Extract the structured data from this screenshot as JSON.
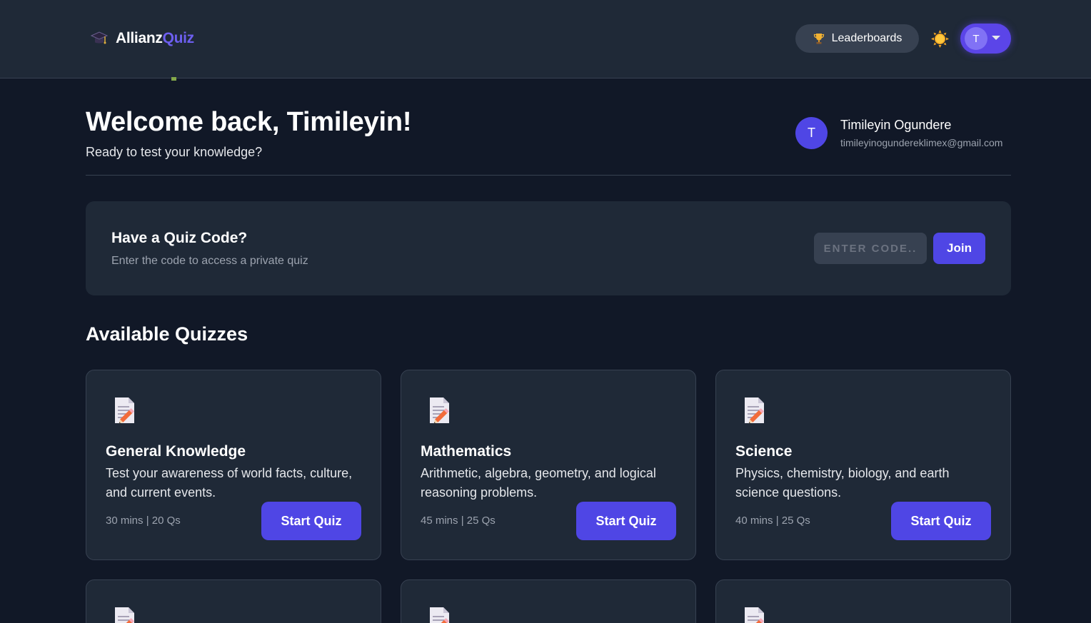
{
  "brand": {
    "name_part1": "Allianz",
    "name_part2": "Quiz",
    "icon": "graduation-cap-icon"
  },
  "nav": {
    "leaderboards_label": "Leaderboards",
    "leaderboards_icon": "trophy-icon",
    "theme_icon": "sun-icon",
    "user_initial": "T"
  },
  "welcome": {
    "title": "Welcome back, Timileyin!",
    "subtitle": "Ready to test your knowledge?"
  },
  "profile": {
    "initial": "T",
    "name": "Timileyin Ogundere",
    "email": "timileyinogundereklimex@gmail.com"
  },
  "quiz_code": {
    "title": "Have a Quiz Code?",
    "subtitle": "Enter the code to access a private quiz",
    "placeholder": "ENTER CODE..",
    "join_label": "Join"
  },
  "section": {
    "title": "Available Quizzes"
  },
  "quizzes": [
    {
      "icon": "memo-icon",
      "title": "General Knowledge",
      "description": "Test your awareness of world facts, culture, and current events.",
      "meta": "30 mins | 20 Qs",
      "button": "Start Quiz"
    },
    {
      "icon": "memo-icon",
      "title": "Mathematics",
      "description": "Arithmetic, algebra, geometry, and logical reasoning problems.",
      "meta": "45 mins | 25 Qs",
      "button": "Start Quiz"
    },
    {
      "icon": "memo-icon",
      "title": "Science",
      "description": "Physics, chemistry, biology, and earth science questions.",
      "meta": "40 mins | 25 Qs",
      "button": "Start Quiz"
    }
  ],
  "colors": {
    "background": "#111827",
    "surface": "#1f2937",
    "accent": "#4f46e5",
    "brand_accent": "#6d5ff0",
    "muted_text": "#9ca3af"
  }
}
